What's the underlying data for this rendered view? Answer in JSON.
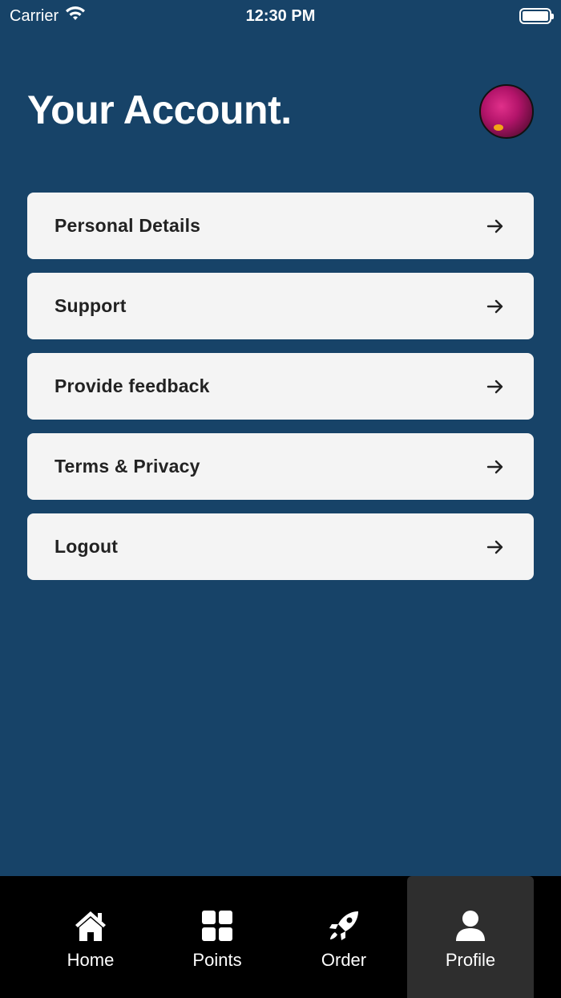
{
  "status_bar": {
    "carrier": "Carrier",
    "time": "12:30 PM"
  },
  "header": {
    "title": "Your Account."
  },
  "menu": {
    "items": [
      {
        "label": "Personal Details"
      },
      {
        "label": "Support"
      },
      {
        "label": "Provide feedback"
      },
      {
        "label": "Terms & Privacy"
      },
      {
        "label": "Logout"
      }
    ]
  },
  "tab_bar": {
    "tabs": [
      {
        "label": "Home",
        "icon": "home-icon"
      },
      {
        "label": "Points",
        "icon": "grid-icon"
      },
      {
        "label": "Order",
        "icon": "rocket-icon"
      },
      {
        "label": "Profile",
        "icon": "user-icon",
        "active": true
      }
    ]
  },
  "colors": {
    "background": "#174368",
    "card": "#f4f4f4",
    "tab_bar": "#000000",
    "tab_active": "#2e2e2e"
  }
}
